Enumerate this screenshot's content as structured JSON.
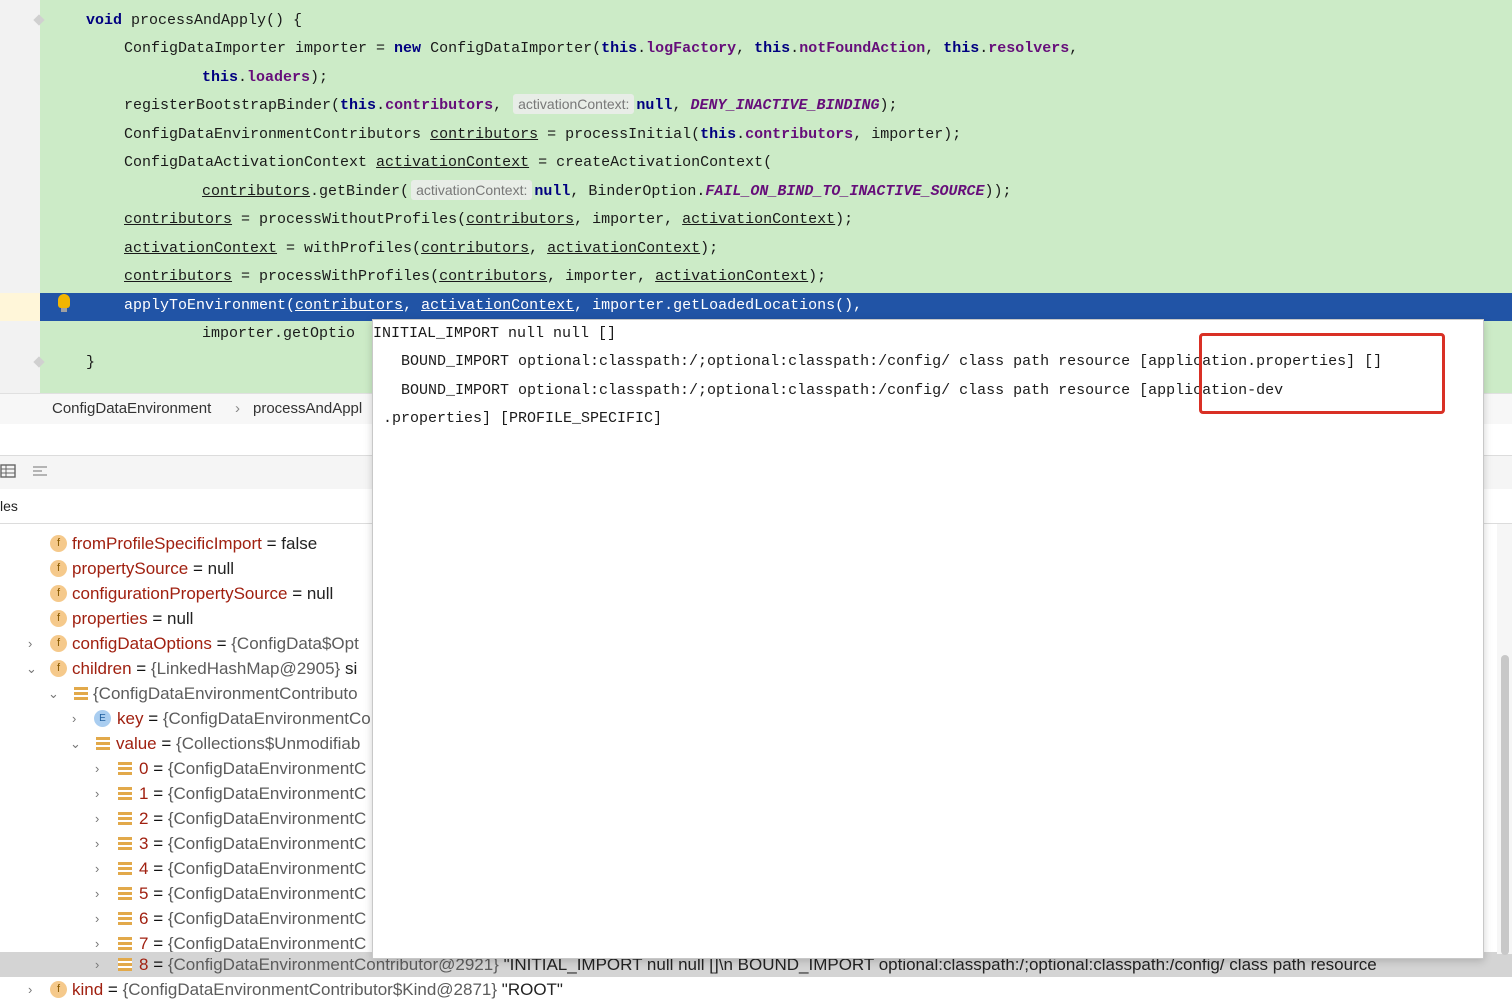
{
  "editor": {
    "line1": {
      "kw": "void",
      "text": " processAndApply() {"
    },
    "line2": {
      "a": "ConfigDataImporter importer = ",
      "new": "new",
      "b": " ConfigDataImporter(",
      "this1": "this",
      "f1": "logFactory",
      "sep1": ", ",
      "this2": "this",
      "f2": "notFoundAction",
      "sep2": ", ",
      "this3": "this",
      "f3": "resolvers",
      "end": ","
    },
    "line3": {
      "this": "this",
      "f": "loaders",
      "end": ");"
    },
    "line4": {
      "a": "registerBootstrapBinder(",
      "this": "this",
      "f": "contributors",
      "sep": ", ",
      "hint": "activationContext:",
      "null": "null",
      "sep2": ", ",
      "const": "DENY_INACTIVE_BINDING",
      "end": ");"
    },
    "line5": {
      "a": "ConfigDataEnvironmentContributors ",
      "u1": "contributors",
      "b": " = processInitial(",
      "this": "this",
      "f": "contributors",
      "end": ", importer);"
    },
    "line6": {
      "a": "ConfigDataActivationContext ",
      "u1": "activationContext",
      "b": " = createActivationContext("
    },
    "line7": {
      "u1": "contributors",
      "a": ".getBinder(",
      "hint": "activationContext:",
      "null": "null",
      "b": ", BinderOption.",
      "const": "FAIL_ON_BIND_TO_INACTIVE_SOURCE",
      "end": "));"
    },
    "line8": {
      "u1": "contributors",
      "a": " = processWithoutProfiles(",
      "u2": "contributors",
      "b": ", importer, ",
      "u3": "activationContext",
      "end": ");"
    },
    "line9": {
      "u1": "activationContext",
      "a": " = withProfiles(",
      "u2": "contributors",
      "b": ", ",
      "u3": "activationContext",
      "end": ");"
    },
    "line10": {
      "u1": "contributors",
      "a": " = processWithProfiles(",
      "u2": "contributors",
      "b": ", importer, ",
      "u3": "activationContext",
      "end": ");"
    },
    "line11": {
      "a": "applyToEnvironment(",
      "u1": "contributors",
      "b": ", ",
      "u2": "activationContext",
      "end": ", importer.getLoadedLocations(),"
    },
    "line12": {
      "text": "importer.getOptio"
    },
    "line13": {
      "text": "}"
    }
  },
  "breadcrumb": {
    "class": "ConfigDataEnvironment",
    "sep": "›",
    "method": "processAndAppl"
  },
  "variables_header": "les",
  "popup": {
    "line1": "INITIAL_IMPORT null null []",
    "line2a": "  BOUND_IMPORT optional:classpath:/;optional:classpath:/config/ class path resource ",
    "line2b": "[application.properties]",
    "line2c": " []",
    "line3a": "  BOUND_IMPORT optional:classpath:/;optional:classpath:/config/ class path resource ",
    "line3b": "[application-dev",
    "line4": ".properties] [PROFILE_SPECIFIC]"
  },
  "tree": [
    {
      "name": "fromProfileSpecificImport",
      "eq": " = ",
      "val": "false"
    },
    {
      "name": "propertySource",
      "eq": " = ",
      "val": "null"
    },
    {
      "name": "configurationPropertySource",
      "eq": " = ",
      "val": "null"
    },
    {
      "name": "properties",
      "eq": " = ",
      "val": "null"
    },
    {
      "name": "configDataOptions",
      "eq": " = ",
      "val": "{ConfigData$Opt"
    },
    {
      "name": "children",
      "eq": " = ",
      "val": "{LinkedHashMap@2905}",
      "extra": "  si"
    },
    {
      "name": "",
      "eq": "",
      "val": "{ConfigDataEnvironmentContributo"
    },
    {
      "name": "key",
      "eq": " = ",
      "val": "{ConfigDataEnvironmentCo"
    },
    {
      "name": "value",
      "eq": " = ",
      "val": "{Collections$Unmodifiab"
    },
    {
      "name": "0",
      "eq": " = ",
      "val": "{ConfigDataEnvironmentC"
    },
    {
      "name": "1",
      "eq": " = ",
      "val": "{ConfigDataEnvironmentC"
    },
    {
      "name": "2",
      "eq": " = ",
      "val": "{ConfigDataEnvironmentC"
    },
    {
      "name": "3",
      "eq": " = ",
      "val": "{ConfigDataEnvironmentC"
    },
    {
      "name": "4",
      "eq": " = ",
      "val": "{ConfigDataEnvironmentC"
    },
    {
      "name": "5",
      "eq": " = ",
      "val": "{ConfigDataEnvironmentC"
    },
    {
      "name": "6",
      "eq": " = ",
      "val": "{ConfigDataEnvironmentC"
    },
    {
      "name": "7",
      "eq": " = ",
      "val": "{ConfigDataEnvironmentC"
    },
    {
      "name": "8",
      "eq": " = ",
      "val": "{ConfigDataEnvironmentContributor@2921}",
      "extra": " \"INITIAL_IMPORT null null []\\n    BOUND_IMPORT optional:classpath:/;optional:classpath:/config/ class path resource"
    },
    {
      "name": "kind",
      "eq": " = ",
      "val": "{ConfigDataEnvironmentContributor$Kind@2871}",
      "extra": " \"ROOT\""
    }
  ],
  "icons": {
    "f": "f",
    "e": "E"
  },
  "colors": {
    "code_bg": "#ccebc7",
    "exec_line": "#2154a6",
    "highlight": "#d93025"
  }
}
